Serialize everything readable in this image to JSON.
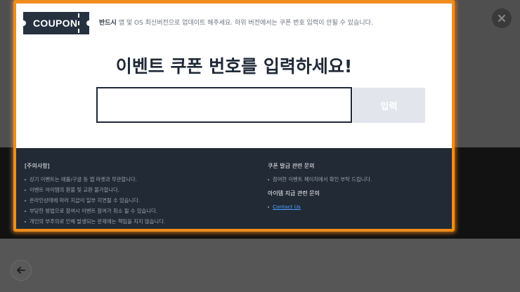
{
  "colors": {
    "accent_border": "#f28c1c",
    "coupon_tag_bg": "#263140",
    "footer_bg": "#222a36",
    "link": "#4da3ff",
    "submit_bg": "#e3e5ec"
  },
  "header": {
    "coupon_label": "COUPON",
    "notice_bold": "반드시",
    "notice_text": " 앱 및 OS 최신버전으로 업데이트 해주세요. 하위 버전에서는 쿠폰 번호 입력이 안될 수 있습니다."
  },
  "main": {
    "headline": "이벤트 쿠폰 번호를 입력하세요!",
    "input_value": "",
    "submit_label": "입력"
  },
  "footer": {
    "notes_title": "[주의사항]",
    "notes": [
      "상기 이벤트는 애플/구글 등 앱 마켓과 무관합니다.",
      "이벤트 아이템의 환불 및 교환 불가합니다.",
      "온라인상태에 따라 지급이 일부 지연될 수 있습니다.",
      "부당한 방법으로 참여시 이벤트 참여가 취소 될 수 있습니다.",
      "개인의 부주의로 인해 발생되는 문제에는 책임을 지지 않습니다."
    ],
    "coupon_inquiry_title": "쿠폰 발급 관련 문의",
    "coupon_inquiry_text": "참여한 이벤트 페이지에서 확인 부탁 드립니다.",
    "item_inquiry_title": "아이템 지급 관련 문의",
    "contact_link": "Contact Us"
  },
  "icons": {
    "close": "close-icon",
    "back": "arrow-left-icon"
  }
}
